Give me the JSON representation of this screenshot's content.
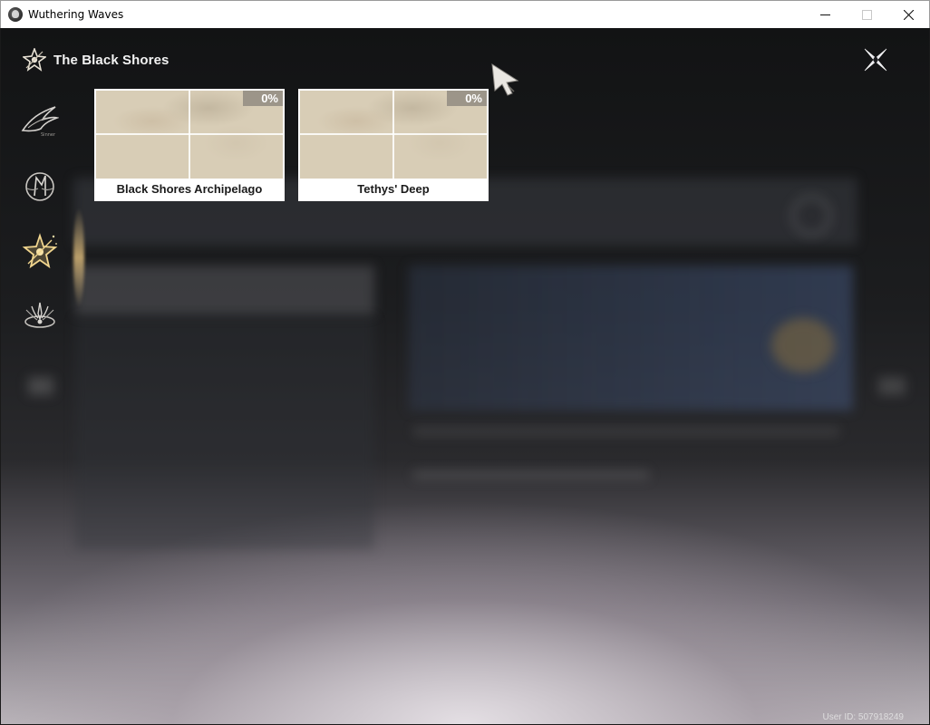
{
  "window": {
    "title": "Wuthering Waves",
    "controls": {
      "minimize": "minimize-icon",
      "maximize": "maximize-icon",
      "close": "close-icon"
    }
  },
  "header": {
    "title": "The Black Shores",
    "icon": "black-shores-emblem-icon"
  },
  "sidebar": {
    "items": [
      {
        "name": "sidebar-item-1",
        "icon": "swallow-wing-icon"
      },
      {
        "name": "sidebar-item-2",
        "icon": "crest-emblem-icon"
      },
      {
        "name": "sidebar-item-3",
        "icon": "black-shores-star-icon",
        "active": true
      },
      {
        "name": "sidebar-item-4",
        "icon": "ornate-crown-icon"
      }
    ]
  },
  "regions": [
    {
      "name": "Black Shores Archipelago",
      "progress": "0%"
    },
    {
      "name": "Tethys' Deep",
      "progress": "0%"
    }
  ],
  "footer": {
    "user_id": "User ID: 507918249"
  },
  "colors": {
    "accent_gold": "#e8c77a",
    "card_bg": "#ffffff",
    "progress_badge": "#9c9589"
  }
}
